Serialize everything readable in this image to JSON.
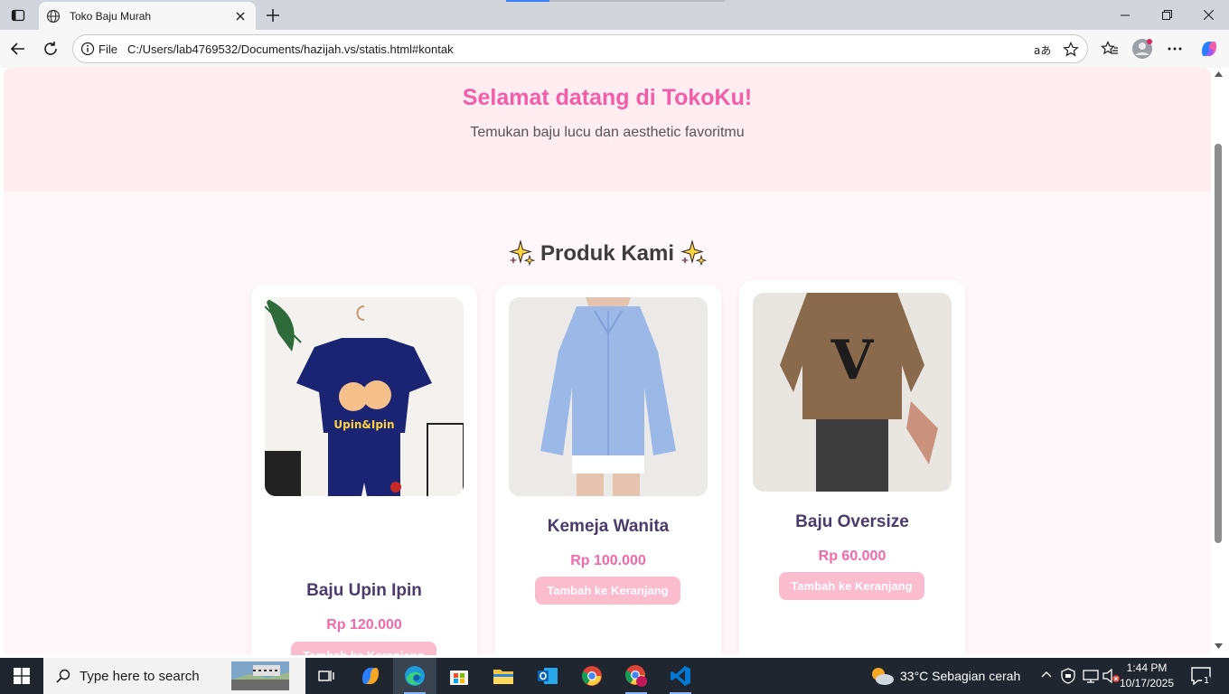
{
  "browser": {
    "tab_title": "Toko Baju Murah",
    "address_prefix": "File",
    "url": "C:/Users/lab4769532/Documents/hazijah.vs/statis.html#kontak"
  },
  "page": {
    "hero_title": "Selamat datang di TokoKu!",
    "hero_subtitle": "Temukan baju lucu dan aesthetic favoritmu",
    "section_title": "Produk Kami",
    "products": [
      {
        "name": "Baju Upin Ipin",
        "price": "Rp 120.000",
        "button": "Tambah ke Keranjang"
      },
      {
        "name": "Kemeja Wanita",
        "price": "Rp 100.000",
        "button": "Tambah ke Keranjang"
      },
      {
        "name": "Baju Oversize",
        "price": "Rp 60.000",
        "button": "Tambah ke Keranjang"
      }
    ]
  },
  "taskbar": {
    "search_placeholder": "Type here to search",
    "weather": "33°C  Sebagian cerah",
    "time": "1:44 PM",
    "date": "10/17/2025"
  },
  "colors": {
    "hero_bg": "#ffedf2",
    "accent_pink": "#f15da7",
    "button_pink": "#fbbccd",
    "product_name": "#4a3b6b"
  }
}
